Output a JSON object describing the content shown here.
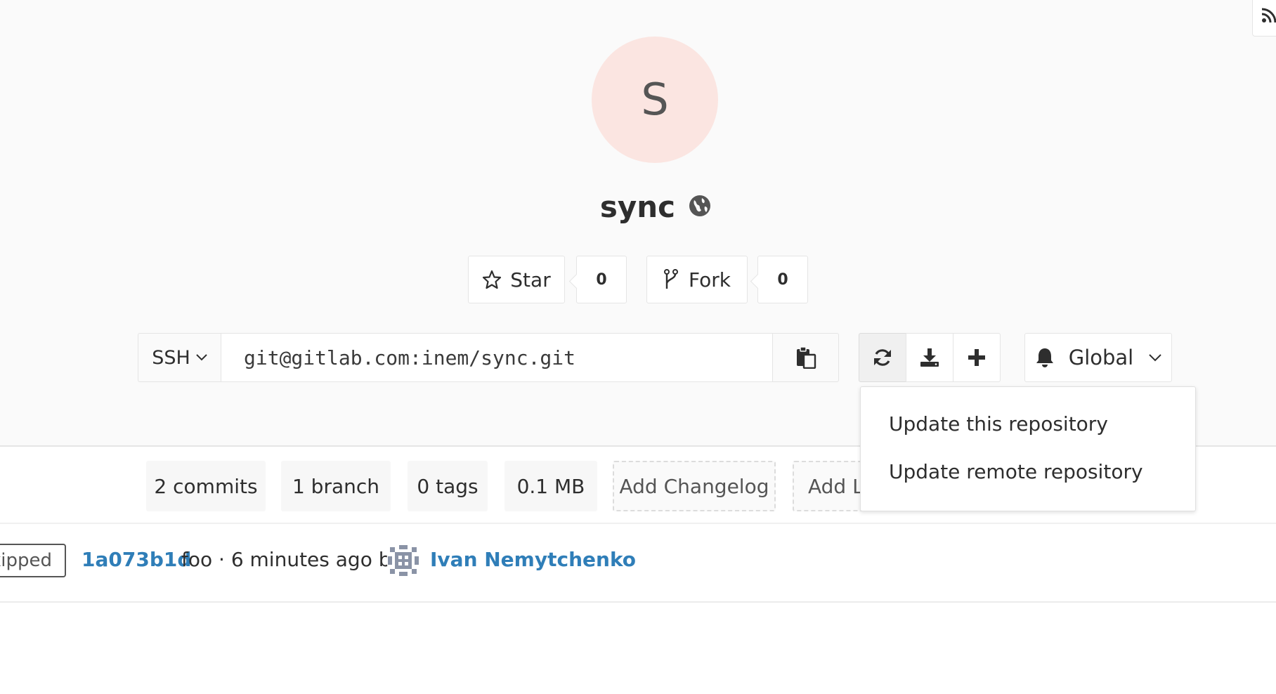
{
  "project": {
    "avatar_letter": "S",
    "name": "sync"
  },
  "social": {
    "star_label": "Star",
    "star_count": "0",
    "fork_label": "Fork",
    "fork_count": "0"
  },
  "clone": {
    "protocol": "SSH",
    "url": "git@gitlab.com:inem/sync.git"
  },
  "notifications": {
    "level": "Global"
  },
  "sync_dropdown": {
    "items": [
      "Update this repository",
      "Update remote repository"
    ]
  },
  "stats": {
    "commits": "2 commits",
    "branches": "1 branch",
    "tags": "0 tags",
    "size": "0.1 MB",
    "add_changelog": "Add Changelog",
    "add_license_partial": "Add L"
  },
  "last_commit": {
    "pipeline_status": "skipped",
    "sha": "1a073b1d",
    "message": "foo · 6 minutes ago by",
    "author": "Ivan Nemytchenko"
  },
  "icons": {
    "rss": "rss-icon",
    "globe": "globe-icon",
    "star": "star-icon",
    "fork": "fork-icon",
    "copy": "clipboard-icon",
    "sync": "refresh-icon",
    "download": "download-icon",
    "add": "plus-icon",
    "bell": "bell-icon"
  },
  "colors": {
    "avatar_bg": "#fbe5e1",
    "link": "#2f7eb8",
    "header_bg": "#fafafa"
  }
}
